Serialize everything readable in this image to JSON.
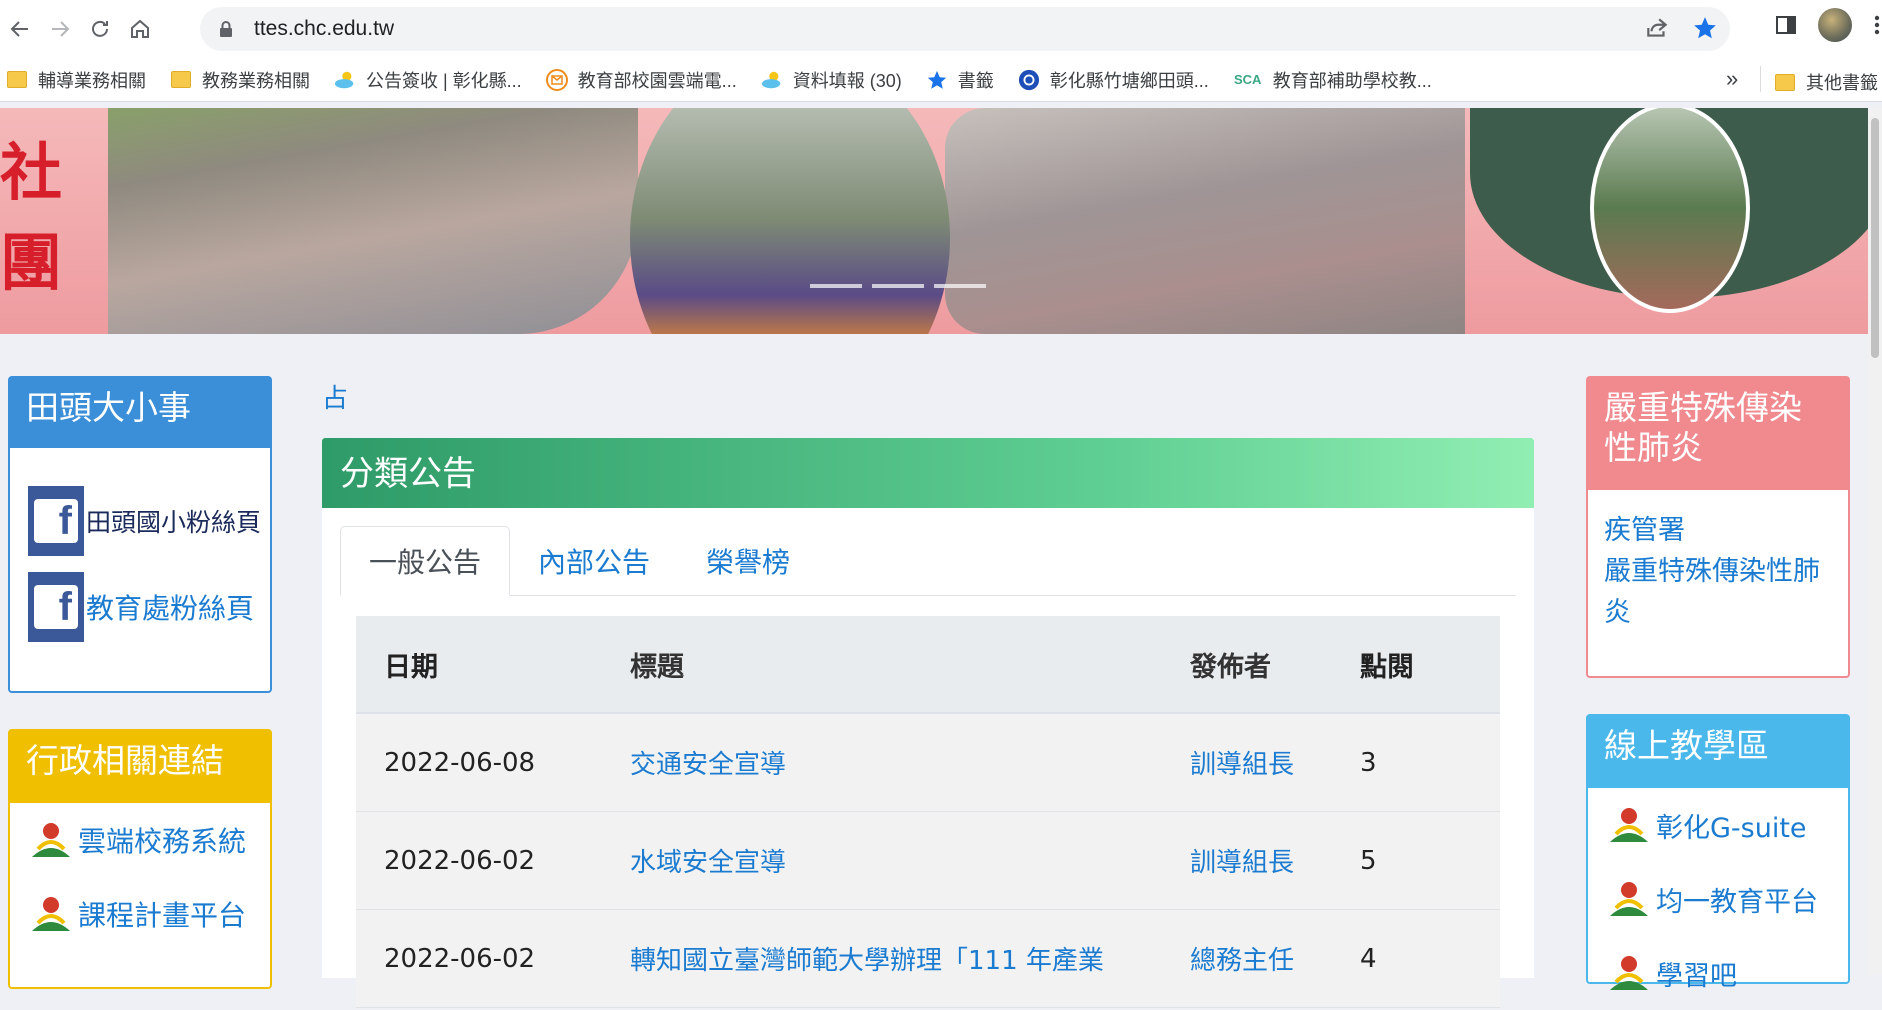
{
  "browser": {
    "url": "ttes.chc.edu.tw",
    "bookmarks": [
      {
        "label": "輔導業務相關",
        "icon": "folder-icon"
      },
      {
        "label": "教務業務相關",
        "icon": "folder-icon"
      },
      {
        "label": "公告簽收 | 彰化縣...",
        "icon": "cloud-icon"
      },
      {
        "label": "教育部校園雲端電...",
        "icon": "mail-icon"
      },
      {
        "label": "資料填報 (30)",
        "icon": "cloud-icon"
      },
      {
        "label": "書籤",
        "icon": "star-icon"
      },
      {
        "label": "彰化縣竹塘鄉田頭...",
        "icon": "site-icon"
      },
      {
        "label": "教育部補助學校教...",
        "icon": "sca-icon"
      }
    ],
    "more": "»",
    "other_bookmarks": "其他書籤",
    "sca_text": "SCA"
  },
  "banner": {
    "title": "社團"
  },
  "left_panel_1": {
    "title": "田頭大小事",
    "links": [
      "田頭國小粉絲頁",
      "教育處粉絲頁"
    ]
  },
  "left_panel_2": {
    "title": "行政相關連結",
    "links": [
      "雲端校務系統",
      "課程計畫平台"
    ]
  },
  "right_panel_1": {
    "title": "嚴重特殊傳染性肺炎",
    "links": [
      "疾管署",
      "嚴重特殊傳染性肺炎"
    ]
  },
  "right_panel_2": {
    "title": "線上教學區",
    "links": [
      "彰化G-suite",
      "均一教育平台",
      "學習吧"
    ]
  },
  "center": {
    "glyph": "占",
    "title": "分類公告",
    "tabs": [
      "一般公告",
      "內部公告",
      "榮譽榜"
    ],
    "columns": [
      "日期",
      "標題",
      "發佈者",
      "點閱"
    ],
    "rows": [
      {
        "date": "2022-06-08",
        "title": "交通安全宣導",
        "author": "訓導組長",
        "views": "3"
      },
      {
        "date": "2022-06-02",
        "title": "水域安全宣導",
        "author": "訓導組長",
        "views": "5"
      },
      {
        "date": "2022-06-02",
        "title": "轉知國立臺灣師範大學辦理「111 年產業",
        "author": "總務主任",
        "views": "4"
      }
    ]
  },
  "colors": {
    "blue_panel": "#3a8fd8",
    "yellow_panel": "#f0c000",
    "pink_panel": "#f08a8f",
    "sky_panel": "#4bb8ec",
    "green_head": "#2e9b68",
    "link": "#1a7bd0"
  }
}
